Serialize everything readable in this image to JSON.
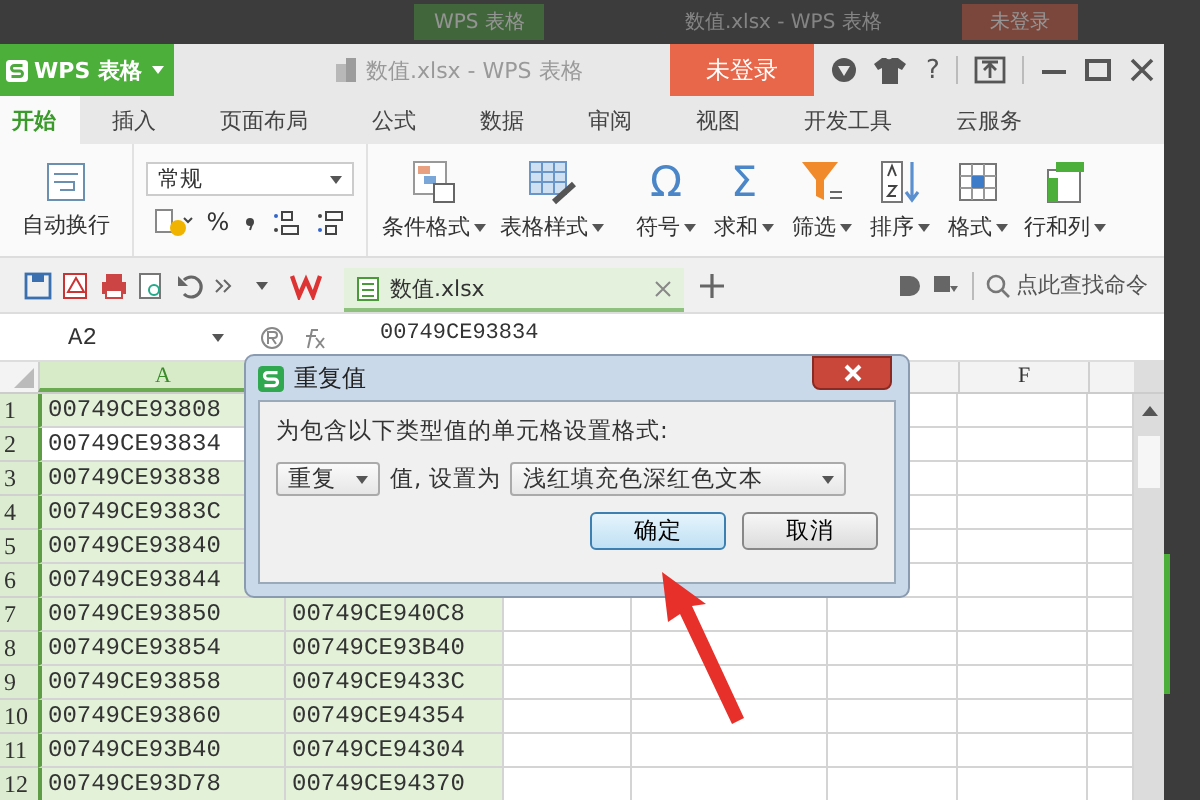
{
  "backdrop": {
    "app_button": "WPS 表格",
    "title": "数值.xlsx - WPS 表格",
    "login_button": "未登录"
  },
  "titlebar": {
    "app_button": "WPS 表格",
    "title": "数值.xlsx - WPS 表格",
    "login_button": "未登录",
    "help": "?"
  },
  "tabs": [
    {
      "label": "开始",
      "selected": true
    },
    {
      "label": "插入",
      "selected": false
    },
    {
      "label": "页面布局",
      "selected": false
    },
    {
      "label": "公式",
      "selected": false
    },
    {
      "label": "数据",
      "selected": false
    },
    {
      "label": "审阅",
      "selected": false
    },
    {
      "label": "视图",
      "selected": false
    },
    {
      "label": "开发工具",
      "selected": false
    },
    {
      "label": "云服务",
      "selected": false
    }
  ],
  "ribbon": {
    "wrap_text": "自动换行",
    "number_format": "常规",
    "percent": "%",
    "commands": [
      {
        "label": "条件格式",
        "kind": "conditional"
      },
      {
        "label": "表格样式",
        "kind": "table-style"
      },
      {
        "label": "符号",
        "kind": "glyph",
        "glyph": "Ω"
      },
      {
        "label": "求和",
        "kind": "glyph",
        "glyph": "Σ"
      },
      {
        "label": "筛选",
        "kind": "filter"
      },
      {
        "label": "排序",
        "kind": "sort"
      },
      {
        "label": "格式",
        "kind": "format"
      },
      {
        "label": "行和列",
        "kind": "rows-cols"
      }
    ]
  },
  "doc_tabs": [
    {
      "label": "数值.xlsx",
      "selected": true
    }
  ],
  "command_search": {
    "placeholder": "点此查找命令"
  },
  "formula_bar": {
    "name_box": "A2",
    "value": "00749CE93834"
  },
  "sheet": {
    "columns": [
      {
        "label": "A",
        "selected": true
      },
      {
        "label": "F",
        "selected": false
      }
    ],
    "rows": [
      {
        "number": "1",
        "cells": [
          "00749CE93808"
        ],
        "selected": true,
        "active": false
      },
      {
        "number": "2",
        "cells": [
          "00749CE93834"
        ],
        "selected": true,
        "active": true
      },
      {
        "number": "3",
        "cells": [
          "00749CE93838"
        ],
        "selected": true,
        "active": false
      },
      {
        "number": "4",
        "cells": [
          "00749CE9383C"
        ],
        "selected": true,
        "active": false
      },
      {
        "number": "5",
        "cells": [
          "00749CE93840"
        ],
        "selected": true,
        "active": false
      },
      {
        "number": "6",
        "cells": [
          "00749CE93844"
        ],
        "selected": true,
        "active": false
      },
      {
        "number": "7",
        "cells": [
          "00749CE93850",
          "00749CE940C8"
        ],
        "selected": true,
        "active": false
      },
      {
        "number": "8",
        "cells": [
          "00749CE93854",
          "00749CE93B40"
        ],
        "selected": true,
        "active": false
      },
      {
        "number": "9",
        "cells": [
          "00749CE93858",
          "00749CE9433C"
        ],
        "selected": true,
        "active": false
      },
      {
        "number": "10",
        "cells": [
          "00749CE93860",
          "00749CE94354"
        ],
        "selected": true,
        "active": false
      },
      {
        "number": "11",
        "cells": [
          "00749CE93B40",
          "00749CE94304"
        ],
        "selected": true,
        "active": false
      },
      {
        "number": "12",
        "cells": [
          "00749CE93D78",
          "00749CE94370"
        ],
        "selected": true,
        "active": false
      }
    ]
  },
  "dialog": {
    "title": "重复值",
    "prompt": "为包含以下类型值的单元格设置格式:",
    "rule": "重复",
    "middle": "值, 设置为",
    "format": "浅红填充色深红色文本",
    "buttons": [
      {
        "label": "确定",
        "focused": true
      },
      {
        "label": "取消",
        "focused": false
      }
    ]
  }
}
